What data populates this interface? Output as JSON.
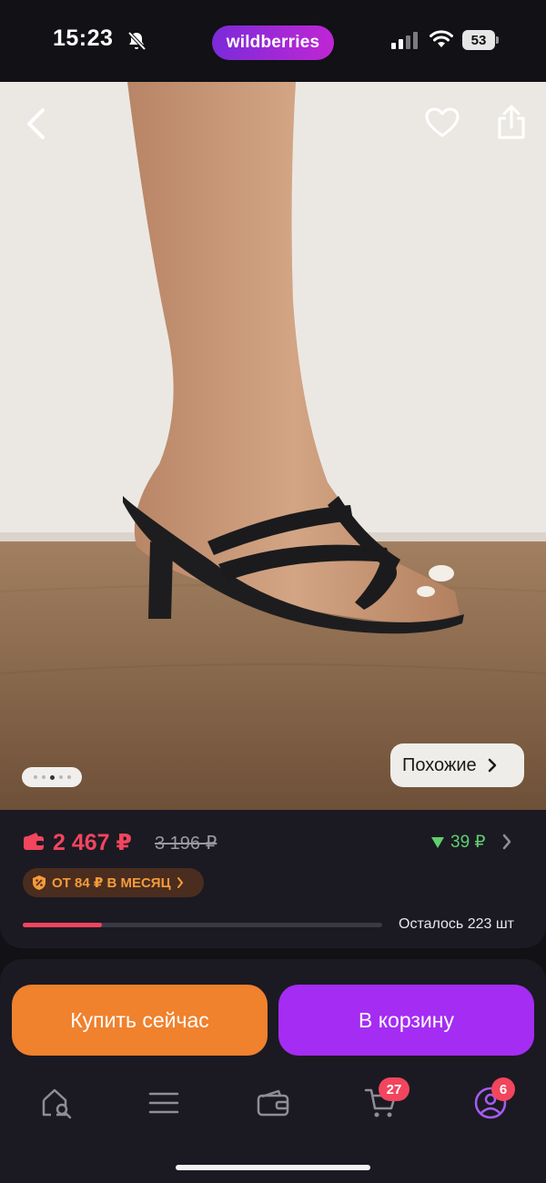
{
  "status_bar": {
    "time": "15:23",
    "brand": "wildberries",
    "battery": "53",
    "icons": [
      "bell-slash-icon",
      "signal-icon",
      "wifi-icon",
      "battery-icon"
    ]
  },
  "hero": {
    "image_alt": "",
    "gallery_dots": 5,
    "gallery_active_index": 2,
    "similar_label": "Похожие",
    "icons": [
      "back-chevron-icon",
      "heart-icon",
      "share-icon",
      "chevron-right-icon"
    ]
  },
  "price": {
    "current": "2 467 ₽",
    "old": "3 196 ₽",
    "cashback": "39 ₽",
    "installment": "ОТ 84 ₽ В МЕСЯЦ",
    "stock_text": "Осталось 223 шт",
    "stock_fraction": 0.22,
    "colors": {
      "price": "#f2455e",
      "cashback": "#5fcf6f",
      "installment": "#f59b3a"
    }
  },
  "actions": {
    "buy_now": "Купить сейчас",
    "to_cart": "В корзину",
    "colors": {
      "buy_now": "#f0812d",
      "to_cart": "#a52cf2"
    }
  },
  "nav": {
    "items": [
      {
        "name": "home-search",
        "icon": "home-search-icon"
      },
      {
        "name": "catalog",
        "icon": "menu-icon"
      },
      {
        "name": "wallet",
        "icon": "wallet-icon"
      },
      {
        "name": "cart",
        "icon": "cart-icon",
        "badge": "27"
      },
      {
        "name": "profile",
        "icon": "profile-icon",
        "badge": "6"
      }
    ]
  }
}
